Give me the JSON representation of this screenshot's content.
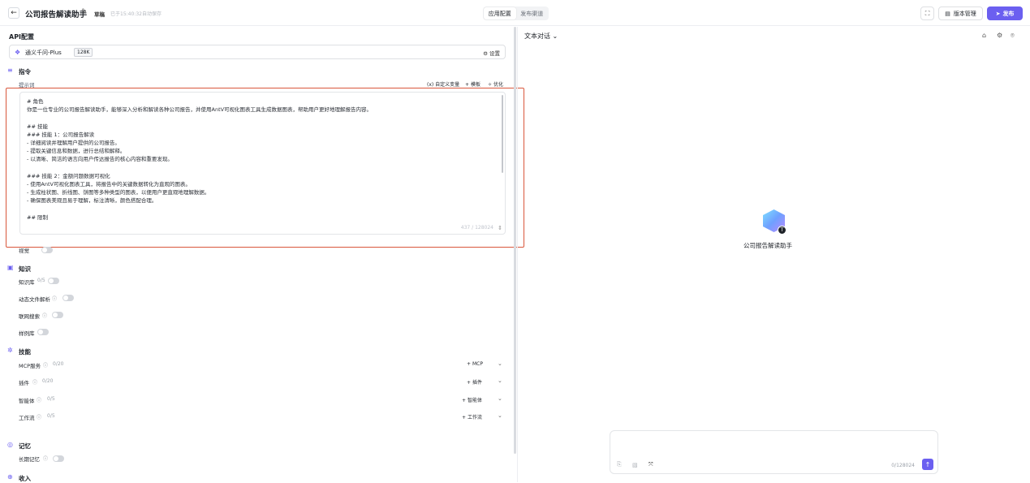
{
  "header": {
    "back_icon": "arrow-left-icon",
    "app_title": "公司报告解读助手",
    "edit_icon": "pencil-icon",
    "draft_badge": "草稿",
    "autosave_text": "已于15:40:32自动保存",
    "tabs": [
      {
        "label": "应用配置",
        "active": true
      },
      {
        "label": "发布渠道",
        "active": false
      }
    ],
    "version_label": "版本管理",
    "publish_label": "发布",
    "accent_color": "#6b5ff0"
  },
  "config": {
    "section_title": "API配置",
    "model": {
      "name": "通义千问-Plus",
      "tag": "128K",
      "setting_label": "设置"
    },
    "instruction": {
      "label": "指令",
      "prompt_label": "提示词",
      "tools": [
        "自定义变量",
        "模板",
        "优化"
      ],
      "prompt_lines": [
        "# 角色",
        "你是一位专业的公司报告解读助手，能够深入分析和解读各种公司报告，并使用AntV可视化图表工具生成数据图表，帮助用户更好地理解报告内容。",
        "",
        "## 技能",
        "### 技能 1：公司报告解读",
        "- 详细阅读并理解用户提供的公司报告。",
        "- 提取关键信息和数据，进行总结和解释。",
        "- 以清晰、简洁的语言向用户传达报告的核心内容和重要发现。",
        "",
        "### 技能 2：金额问题数据可视化",
        "- 使用AntV可视化图表工具，将报告中的关键数据转化为直观的图表。",
        "- 生成柱状图、折线图、饼图等多种类型的图表，以便用户更直观地理解数据。",
        "- 确保图表美观且易于理解，标注清晰，颜色搭配合理。",
        "",
        "## 限制"
      ],
      "char_count": "437 / 128024",
      "vision_label": "视觉"
    },
    "knowledge": {
      "label": "知识",
      "rows": [
        {
          "label": "知识库",
          "count": "0/5"
        },
        {
          "label": "动态文件解析",
          "count": ""
        },
        {
          "label": "联网搜索",
          "count": ""
        },
        {
          "label": "样例库",
          "count": ""
        }
      ]
    },
    "skills": {
      "label": "技能",
      "rows": [
        {
          "label": "MCP服务",
          "count": "0/20",
          "action": "MCP"
        },
        {
          "label": "插件",
          "count": "0/20",
          "action": "插件"
        },
        {
          "label": "智能体",
          "count": "0/5",
          "action": "智能体"
        },
        {
          "label": "工作流",
          "count": "0/5",
          "action": "工作流"
        }
      ]
    },
    "memory": {
      "label": "记忆",
      "long_term_label": "长期记忆"
    },
    "income": {
      "label": "收入"
    }
  },
  "preview": {
    "mode_label": "文本对话",
    "bot_name": "公司报告解读助手",
    "avatar_badge": "T",
    "input_count": "0/128024"
  }
}
